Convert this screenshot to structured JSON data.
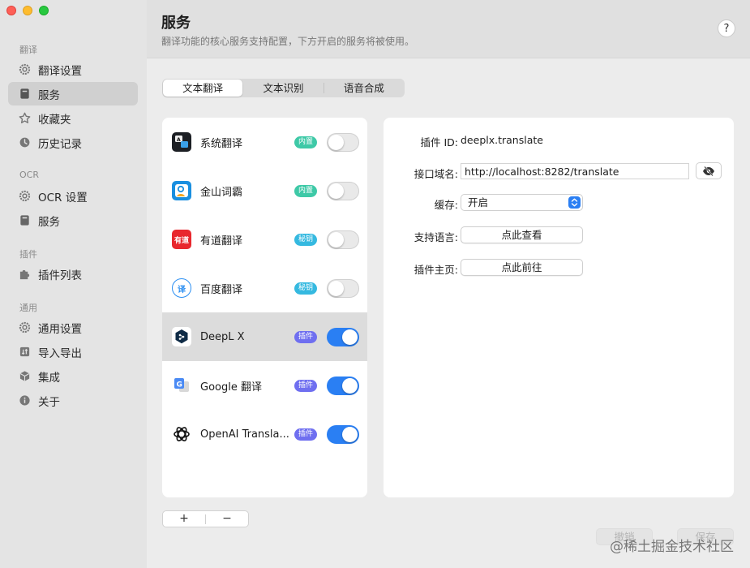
{
  "window": {
    "controls": [
      "close",
      "minimize",
      "maximize"
    ]
  },
  "sidebar": {
    "sections": [
      {
        "title": "翻译",
        "items": [
          {
            "label": "翻译设置",
            "icon": "gear-icon"
          },
          {
            "label": "服务",
            "icon": "bookmark-icon",
            "active": true
          },
          {
            "label": "收藏夹",
            "icon": "star-icon"
          },
          {
            "label": "历史记录",
            "icon": "clock-icon"
          }
        ]
      },
      {
        "title": "OCR",
        "items": [
          {
            "label": "OCR 设置",
            "icon": "gear-icon"
          },
          {
            "label": "服务",
            "icon": "bookmark-icon"
          }
        ]
      },
      {
        "title": "插件",
        "items": [
          {
            "label": "插件列表",
            "icon": "puzzle-icon"
          }
        ]
      },
      {
        "title": "通用",
        "items": [
          {
            "label": "通用设置",
            "icon": "gear-icon"
          },
          {
            "label": "导入导出",
            "icon": "import-export-icon"
          },
          {
            "label": "集成",
            "icon": "cube-icon"
          },
          {
            "label": "关于",
            "icon": "info-icon"
          }
        ]
      }
    ]
  },
  "header": {
    "title": "服务",
    "subtitle": "翻译功能的核心服务支持配置，下方开启的服务将被使用。",
    "help_label": "?"
  },
  "tabs": [
    {
      "label": "文本翻译",
      "active": true
    },
    {
      "label": "文本识别",
      "active": false
    },
    {
      "label": "语音合成",
      "active": false
    }
  ],
  "services": [
    {
      "name": "系统翻译",
      "badge": "内置",
      "badge_color": "#3ec9a7",
      "enabled": false,
      "active": false,
      "logo": "system-translate-logo-icon"
    },
    {
      "name": "金山词霸",
      "badge": "内置",
      "badge_color": "#3ec9a7",
      "enabled": false,
      "active": false,
      "logo": "kingsoft-logo-icon"
    },
    {
      "name": "有道翻译",
      "badge": "秘钥",
      "badge_color": "#35b9e0",
      "enabled": false,
      "active": false,
      "logo": "youdao-logo-icon",
      "logo_text": "有道"
    },
    {
      "name": "百度翻译",
      "badge": "秘钥",
      "badge_color": "#35b9e0",
      "enabled": false,
      "active": false,
      "logo": "baidu-logo-icon",
      "logo_text": "译"
    },
    {
      "name": "DeepL X",
      "badge": "插件",
      "badge_color": "#6f6ff0",
      "enabled": true,
      "active": true,
      "logo": "deepl-logo-icon"
    },
    {
      "name": "Google 翻译",
      "badge": "插件",
      "badge_color": "#6f6ff0",
      "enabled": true,
      "active": false,
      "logo": "google-translate-logo-icon",
      "logo_text": "G"
    },
    {
      "name": "OpenAI Transla...",
      "badge": "插件",
      "badge_color": "#6f6ff0",
      "enabled": true,
      "active": false,
      "logo": "openai-logo-icon"
    }
  ],
  "list_controls": {
    "add": "+",
    "remove": "−"
  },
  "detail": {
    "plugin_id_label": "插件 ID:",
    "plugin_id_value": "deeplx.translate",
    "domain_label": "接口域名:",
    "domain_value": "http://localhost:8282/translate",
    "cache_label": "缓存:",
    "cache_value": "开启",
    "languages_label": "支持语言:",
    "languages_button": "点此查看",
    "homepage_label": "插件主页:",
    "homepage_button": "点此前往"
  },
  "footer": {
    "cancel": "撤销",
    "save": "保存",
    "watermark": "@稀土掘金技术社区"
  },
  "colors": {
    "accent": "#2a7ff3",
    "builtin_badge": "#3ec9a7",
    "key_badge": "#35b9e0",
    "plugin_badge": "#6f6ff0"
  }
}
